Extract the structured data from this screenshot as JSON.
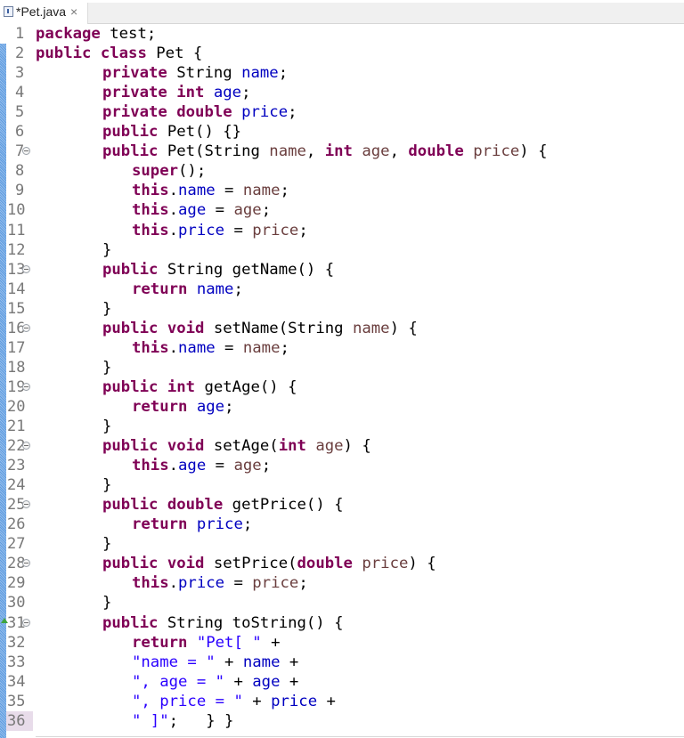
{
  "tab": {
    "label": "*Pet.java",
    "close_icon": "×",
    "icon": "java-file-icon",
    "dirty": true
  },
  "colors": {
    "keyword": "#7f0055",
    "field": "#0000c0",
    "parameter": "#6a3e3e",
    "string": "#2a00ff",
    "change_ruler": "#5d9be0",
    "current_line_gutter": "#e8dcea",
    "override_marker": "#3fa33f"
  },
  "lines": [
    {
      "n": "1",
      "indent": 0,
      "tokens": [
        [
          "kw",
          "package"
        ],
        [
          "pl",
          " test;"
        ]
      ]
    },
    {
      "n": "2",
      "indent": 0,
      "tokens": [
        [
          "kw",
          "public"
        ],
        [
          "pl",
          " "
        ],
        [
          "kw",
          "class"
        ],
        [
          "pl",
          " Pet {"
        ]
      ]
    },
    {
      "n": "3",
      "indent": 1,
      "tokens": [
        [
          "kw",
          "private"
        ],
        [
          "pl",
          " String "
        ],
        [
          "fld",
          "name"
        ],
        [
          "pl",
          ";"
        ]
      ]
    },
    {
      "n": "4",
      "indent": 1,
      "tokens": [
        [
          "kw",
          "private"
        ],
        [
          "pl",
          " "
        ],
        [
          "kw",
          "int"
        ],
        [
          "pl",
          " "
        ],
        [
          "fld",
          "age"
        ],
        [
          "pl",
          ";"
        ]
      ]
    },
    {
      "n": "5",
      "indent": 1,
      "tokens": [
        [
          "kw",
          "private"
        ],
        [
          "pl",
          " "
        ],
        [
          "kw",
          "double"
        ],
        [
          "pl",
          " "
        ],
        [
          "fld",
          "price"
        ],
        [
          "pl",
          ";"
        ]
      ]
    },
    {
      "n": "6",
      "indent": 1,
      "tokens": [
        [
          "kw",
          "public"
        ],
        [
          "pl",
          " Pet() {}"
        ]
      ]
    },
    {
      "n": "7",
      "indent": 1,
      "fold": true,
      "tokens": [
        [
          "kw",
          "public"
        ],
        [
          "pl",
          " Pet(String "
        ],
        [
          "par",
          "name"
        ],
        [
          "pl",
          ", "
        ],
        [
          "kw",
          "int"
        ],
        [
          "pl",
          " "
        ],
        [
          "par",
          "age"
        ],
        [
          "pl",
          ", "
        ],
        [
          "kw",
          "double"
        ],
        [
          "pl",
          " "
        ],
        [
          "par",
          "price"
        ],
        [
          "pl",
          ") {"
        ]
      ]
    },
    {
      "n": "8",
      "indent": 2,
      "tokens": [
        [
          "kw",
          "super"
        ],
        [
          "pl",
          "();"
        ]
      ]
    },
    {
      "n": "9",
      "indent": 2,
      "tokens": [
        [
          "kw",
          "this"
        ],
        [
          "pl",
          "."
        ],
        [
          "fld",
          "name"
        ],
        [
          "pl",
          " = "
        ],
        [
          "par",
          "name"
        ],
        [
          "pl",
          ";"
        ]
      ]
    },
    {
      "n": "10",
      "indent": 2,
      "tokens": [
        [
          "kw",
          "this"
        ],
        [
          "pl",
          "."
        ],
        [
          "fld",
          "age"
        ],
        [
          "pl",
          " = "
        ],
        [
          "par",
          "age"
        ],
        [
          "pl",
          ";"
        ]
      ]
    },
    {
      "n": "11",
      "indent": 2,
      "tokens": [
        [
          "kw",
          "this"
        ],
        [
          "pl",
          "."
        ],
        [
          "fld",
          "price"
        ],
        [
          "pl",
          " = "
        ],
        [
          "par",
          "price"
        ],
        [
          "pl",
          ";"
        ]
      ]
    },
    {
      "n": "12",
      "indent": 1,
      "tokens": [
        [
          "pl",
          "}"
        ]
      ]
    },
    {
      "n": "13",
      "indent": 1,
      "fold": true,
      "tokens": [
        [
          "kw",
          "public"
        ],
        [
          "pl",
          " String getName() {"
        ]
      ]
    },
    {
      "n": "14",
      "indent": 2,
      "tokens": [
        [
          "kw",
          "return"
        ],
        [
          "pl",
          " "
        ],
        [
          "fld",
          "name"
        ],
        [
          "pl",
          ";"
        ]
      ]
    },
    {
      "n": "15",
      "indent": 1,
      "tokens": [
        [
          "pl",
          "}"
        ]
      ]
    },
    {
      "n": "16",
      "indent": 1,
      "fold": true,
      "tokens": [
        [
          "kw",
          "public"
        ],
        [
          "pl",
          " "
        ],
        [
          "kw",
          "void"
        ],
        [
          "pl",
          " setName(String "
        ],
        [
          "par",
          "name"
        ],
        [
          "pl",
          ") {"
        ]
      ]
    },
    {
      "n": "17",
      "indent": 2,
      "tokens": [
        [
          "kw",
          "this"
        ],
        [
          "pl",
          "."
        ],
        [
          "fld",
          "name"
        ],
        [
          "pl",
          " = "
        ],
        [
          "par",
          "name"
        ],
        [
          "pl",
          ";"
        ]
      ]
    },
    {
      "n": "18",
      "indent": 1,
      "tokens": [
        [
          "pl",
          "}"
        ]
      ]
    },
    {
      "n": "19",
      "indent": 1,
      "fold": true,
      "tokens": [
        [
          "kw",
          "public"
        ],
        [
          "pl",
          " "
        ],
        [
          "kw",
          "int"
        ],
        [
          "pl",
          " getAge() {"
        ]
      ]
    },
    {
      "n": "20",
      "indent": 2,
      "tokens": [
        [
          "kw",
          "return"
        ],
        [
          "pl",
          " "
        ],
        [
          "fld",
          "age"
        ],
        [
          "pl",
          ";"
        ]
      ]
    },
    {
      "n": "21",
      "indent": 1,
      "tokens": [
        [
          "pl",
          "}"
        ]
      ]
    },
    {
      "n": "22",
      "indent": 1,
      "fold": true,
      "tokens": [
        [
          "kw",
          "public"
        ],
        [
          "pl",
          " "
        ],
        [
          "kw",
          "void"
        ],
        [
          "pl",
          " setAge("
        ],
        [
          "kw",
          "int"
        ],
        [
          "pl",
          " "
        ],
        [
          "par",
          "age"
        ],
        [
          "pl",
          ") {"
        ]
      ]
    },
    {
      "n": "23",
      "indent": 2,
      "tokens": [
        [
          "kw",
          "this"
        ],
        [
          "pl",
          "."
        ],
        [
          "fld",
          "age"
        ],
        [
          "pl",
          " = "
        ],
        [
          "par",
          "age"
        ],
        [
          "pl",
          ";"
        ]
      ]
    },
    {
      "n": "24",
      "indent": 1,
      "tokens": [
        [
          "pl",
          "}"
        ]
      ]
    },
    {
      "n": "25",
      "indent": 1,
      "fold": true,
      "tokens": [
        [
          "kw",
          "public"
        ],
        [
          "pl",
          " "
        ],
        [
          "kw",
          "double"
        ],
        [
          "pl",
          " getPrice() {"
        ]
      ]
    },
    {
      "n": "26",
      "indent": 2,
      "tokens": [
        [
          "kw",
          "return"
        ],
        [
          "pl",
          " "
        ],
        [
          "fld",
          "price"
        ],
        [
          "pl",
          ";"
        ]
      ]
    },
    {
      "n": "27",
      "indent": 1,
      "tokens": [
        [
          "pl",
          "}"
        ]
      ]
    },
    {
      "n": "28",
      "indent": 1,
      "fold": true,
      "tokens": [
        [
          "kw",
          "public"
        ],
        [
          "pl",
          " "
        ],
        [
          "kw",
          "void"
        ],
        [
          "pl",
          " setPrice("
        ],
        [
          "kw",
          "double"
        ],
        [
          "pl",
          " "
        ],
        [
          "par",
          "price"
        ],
        [
          "pl",
          ") {"
        ]
      ]
    },
    {
      "n": "29",
      "indent": 2,
      "tokens": [
        [
          "kw",
          "this"
        ],
        [
          "pl",
          "."
        ],
        [
          "fld",
          "price"
        ],
        [
          "pl",
          " = "
        ],
        [
          "par",
          "price"
        ],
        [
          "pl",
          ";"
        ]
      ]
    },
    {
      "n": "30",
      "indent": 1,
      "tokens": [
        [
          "pl",
          "}"
        ]
      ]
    },
    {
      "n": "31",
      "indent": 1,
      "fold": true,
      "override": true,
      "tokens": [
        [
          "kw",
          "public"
        ],
        [
          "pl",
          " String toString() {"
        ]
      ]
    },
    {
      "n": "32",
      "indent": 2,
      "tokens": [
        [
          "kw",
          "return"
        ],
        [
          "pl",
          " "
        ],
        [
          "str",
          "\"Pet[ \""
        ],
        [
          "pl",
          " +"
        ]
      ]
    },
    {
      "n": "33",
      "indent": 2,
      "tokens": [
        [
          "str",
          "\"name = \""
        ],
        [
          "pl",
          " + "
        ],
        [
          "fld",
          "name"
        ],
        [
          "pl",
          " +"
        ]
      ]
    },
    {
      "n": "34",
      "indent": 2,
      "tokens": [
        [
          "str",
          "\", age = \""
        ],
        [
          "pl",
          " + "
        ],
        [
          "fld",
          "age"
        ],
        [
          "pl",
          " +"
        ]
      ]
    },
    {
      "n": "35",
      "indent": 2,
      "tokens": [
        [
          "str",
          "\", price = \""
        ],
        [
          "pl",
          " + "
        ],
        [
          "fld",
          "price"
        ],
        [
          "pl",
          " +"
        ]
      ]
    },
    {
      "n": "36",
      "indent": 2,
      "current": true,
      "tokens": [
        [
          "str",
          "\" ]\""
        ],
        [
          "pl",
          ";   } }"
        ]
      ]
    }
  ]
}
